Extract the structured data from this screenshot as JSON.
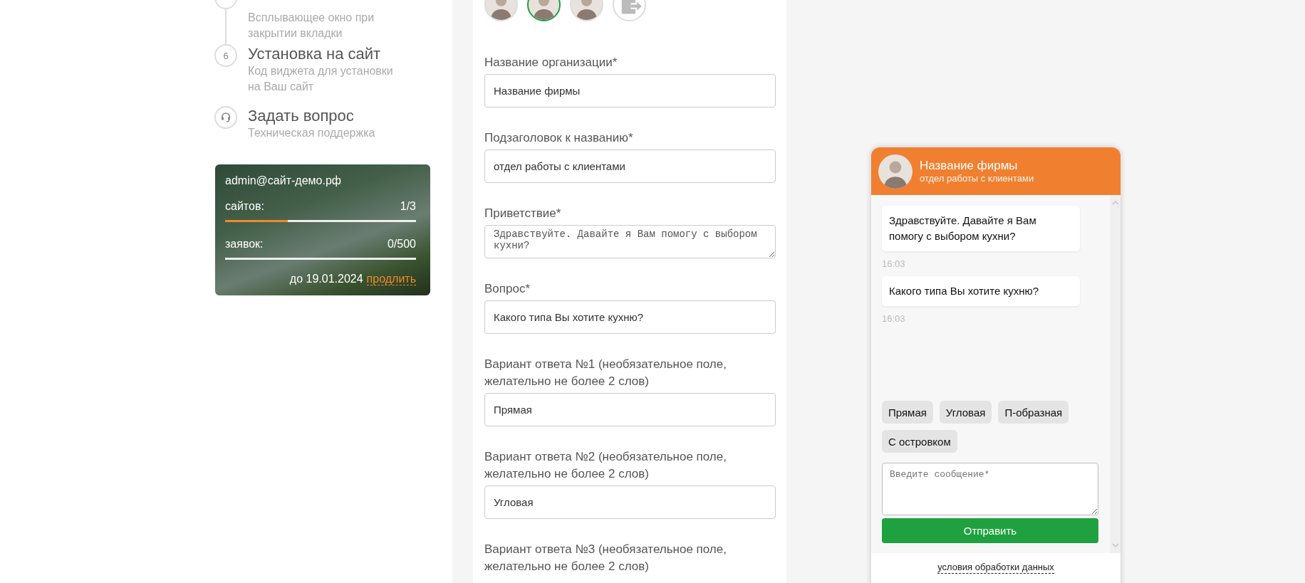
{
  "steps": [
    {
      "kind": "number",
      "subtitle": "Всплывающее окно при закрытии вкладки"
    },
    {
      "kind": "number",
      "number": "6",
      "title": "Установка на сайт",
      "subtitle": "Код виджета для установки на Ваш сайт"
    },
    {
      "kind": "support",
      "title": "Задать вопрос",
      "subtitle": "Техническая поддержка"
    }
  ],
  "account": {
    "email": "admin@сайт-демо.рф",
    "stats": [
      {
        "label": "сайтов:",
        "value": "1/3",
        "level": 0.33
      },
      {
        "label": "заявок:",
        "value": "0/500",
        "level": 0
      }
    ],
    "expires": "до 19.01.2024",
    "renew_link": "продлить"
  },
  "avatars": [
    {
      "kind": "photo",
      "selected": false
    },
    {
      "kind": "photo",
      "selected": true
    },
    {
      "kind": "photo",
      "selected": false
    },
    {
      "kind": "upload",
      "selected": false
    }
  ],
  "form": {
    "fields": [
      {
        "kind": "input",
        "label": "Название организации*",
        "value": "Название фирмы"
      },
      {
        "kind": "input",
        "label": "Подзаголовок к названию*",
        "value": "отдел работы с клиентами"
      },
      {
        "kind": "textarea",
        "label": "Приветствие*",
        "value": "Здравствуйте. Давайте я Вам помогу с выбором кухни?"
      },
      {
        "kind": "input",
        "label": "Вопрос*",
        "value": "Какого типа Вы хотите кухню?"
      },
      {
        "kind": "input",
        "label": "Вариант ответа №1 (необязательное поле, желательно не более 2 слов)",
        "value": "Прямая"
      },
      {
        "kind": "input",
        "label": "Вариант ответа №2 (необязательное поле, желательно не более 2 слов)",
        "value": "Угловая"
      },
      {
        "label": "Вариант ответа №3 (необязательное поле, желательно не более 2 слов)"
      }
    ]
  },
  "chat": {
    "title": "Название фирмы",
    "subtitle": "отдел работы с клиентами",
    "messages": [
      {
        "text": "Здравствуйте. Давайте я Вам помогу с выбором кухни?",
        "time": "16:03"
      },
      {
        "text": "Какого типа Вы хотите кухню?",
        "time": "16:03"
      }
    ],
    "options": [
      "Прямая",
      "Угловая",
      "П-образная",
      "С островком"
    ],
    "placeholder": "Введите сообщение*",
    "send_button": "Отправить",
    "footer_link": "условия обработки данных"
  }
}
